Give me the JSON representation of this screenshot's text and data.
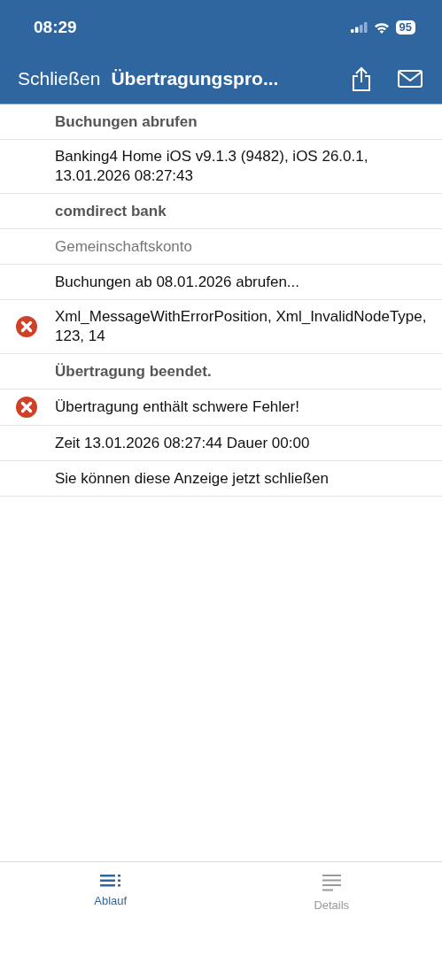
{
  "status_bar": {
    "time": "08:29",
    "battery": "95"
  },
  "nav_bar": {
    "close": "Schließen",
    "title": "Übertragungspro..."
  },
  "log": [
    {
      "kind": "heading",
      "text": "Buchungen abrufen"
    },
    {
      "kind": "normal",
      "text": "Banking4 Home iOS v9.1.3 (9482), iOS 26.0.1, 13.01.2026 08:27:43"
    },
    {
      "kind": "heading",
      "text": "comdirect bank"
    },
    {
      "kind": "muted",
      "text": "Gemeinschaftskonto"
    },
    {
      "kind": "normal",
      "text": "Buchungen ab 08.01.2026 abrufen..."
    },
    {
      "kind": "error",
      "text": "Xml_MessageWithErrorPosition, Xml_InvalidNodeType, 123, 14"
    },
    {
      "kind": "heading",
      "text": "Übertragung beendet."
    },
    {
      "kind": "error",
      "text": "Übertragung enthält schwere Fehler!"
    },
    {
      "kind": "normal",
      "text": "Zeit 13.01.2026 08:27:44 Dauer 00:00"
    },
    {
      "kind": "normal",
      "text": "Sie können diese Anzeige jetzt schließen"
    }
  ],
  "tabs": [
    {
      "label": "Ablauf",
      "selected": true
    },
    {
      "label": "Details",
      "selected": false
    }
  ]
}
